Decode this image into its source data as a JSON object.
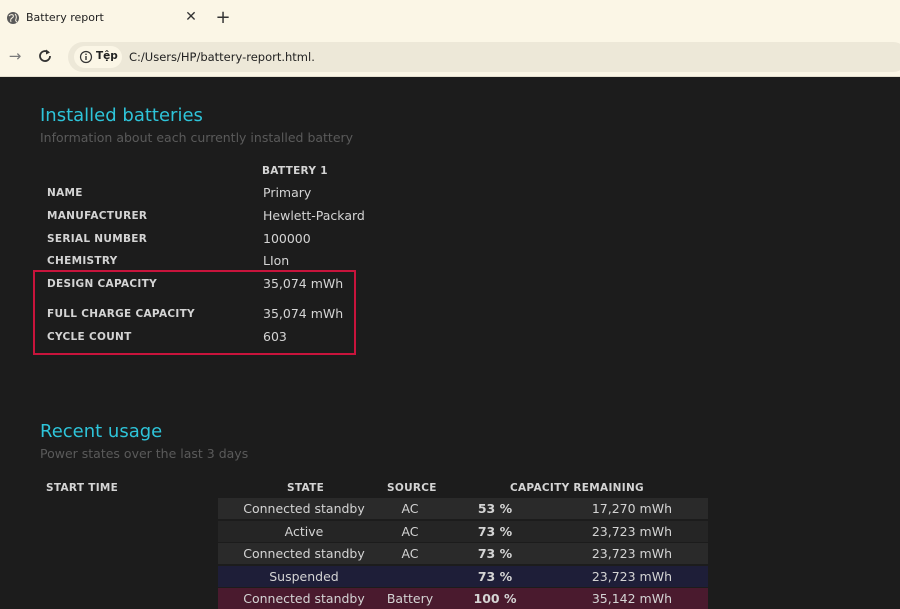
{
  "browser": {
    "tab_title": "Battery report",
    "close_glyph": "✕",
    "new_tab_glyph": "+",
    "forward_glyph": "→",
    "chip_label": "Tệp",
    "url": "C:/Users/HP/battery-report.html."
  },
  "installed": {
    "title": "Installed batteries",
    "subtitle": "Information about each currently installed battery",
    "column_header": "BATTERY 1",
    "rows": [
      {
        "label": "NAME",
        "value": "Primary"
      },
      {
        "label": "MANUFACTURER",
        "value": "Hewlett-Packard"
      },
      {
        "label": "SERIAL NUMBER",
        "value": "100000"
      },
      {
        "label": "CHEMISTRY",
        "value": "LIon"
      },
      {
        "label": "DESIGN CAPACITY",
        "value": "35,074 mWh"
      },
      {
        "label": "FULL CHARGE CAPACITY",
        "value": "35,074 mWh"
      },
      {
        "label": "CYCLE COUNT",
        "value": "603"
      }
    ],
    "highlight_color": "#c8143c"
  },
  "usage": {
    "title": "Recent usage",
    "subtitle": "Power states over the last 3 days",
    "headers": {
      "start_time": "START TIME",
      "state": "STATE",
      "source": "SOURCE",
      "capacity": "CAPACITY REMAINING"
    },
    "rows": [
      {
        "state": "Connected standby",
        "source": "AC",
        "percent": "53 %",
        "mwh": "17,270 mWh",
        "bg": "#2a2a2a"
      },
      {
        "state": "Active",
        "source": "AC",
        "percent": "73 %",
        "mwh": "23,723 mWh",
        "bg": "#252525"
      },
      {
        "state": "Connected standby",
        "source": "AC",
        "percent": "73 %",
        "mwh": "23,723 mWh",
        "bg": "#2a2a2a"
      },
      {
        "state": "Suspended",
        "source": "",
        "percent": "73 %",
        "mwh": "23,723 mWh",
        "bg": "#1e1e38"
      },
      {
        "state": "Connected standby",
        "source": "Battery",
        "percent": "100 %",
        "mwh": "35,142 mWh",
        "bg": "#4a1a2e"
      }
    ]
  },
  "colors": {
    "accent": "#2ec4d9",
    "page_bg": "#1c1c1c",
    "chrome_bg": "#fbf6e6"
  }
}
